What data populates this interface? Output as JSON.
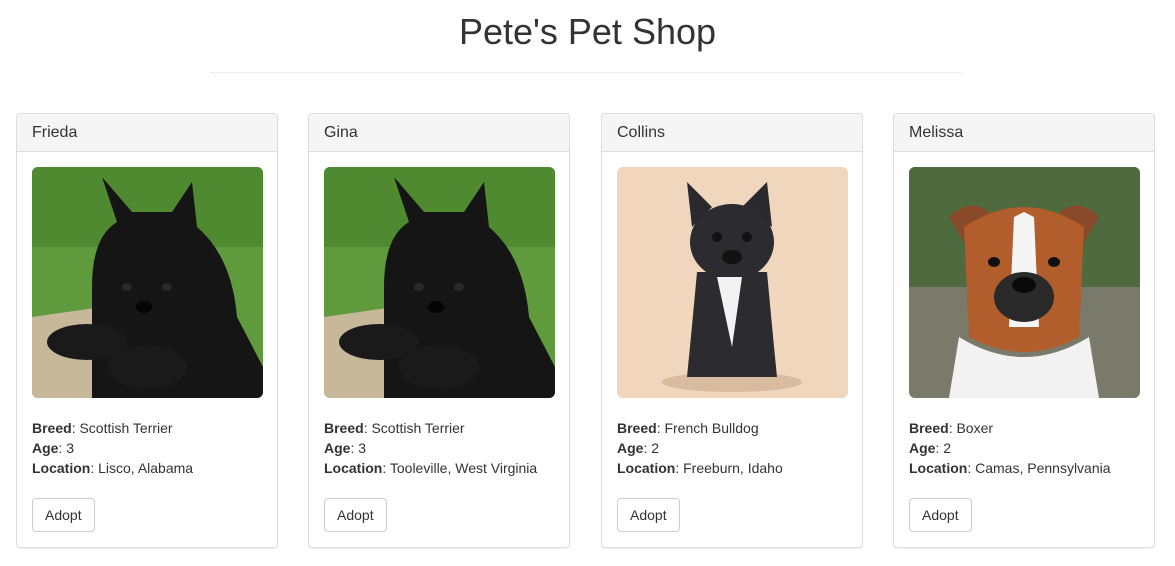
{
  "header": {
    "title": "Pete's Pet Shop"
  },
  "labels": {
    "breed": "Breed",
    "age": "Age",
    "location": "Location"
  },
  "pets": [
    {
      "name": "Frieda",
      "breed": "Scottish Terrier",
      "age": "3",
      "location": "Lisco, Alabama",
      "adopt_label": "Adopt",
      "photo": "scottish-terrier-photo"
    },
    {
      "name": "Gina",
      "breed": "Scottish Terrier",
      "age": "3",
      "location": "Tooleville, West Virginia",
      "adopt_label": "Adopt",
      "photo": "scottish-terrier-photo"
    },
    {
      "name": "Collins",
      "breed": "French Bulldog",
      "age": "2",
      "location": "Freeburn, Idaho",
      "adopt_label": "Adopt",
      "photo": "french-bulldog-photo"
    },
    {
      "name": "Melissa",
      "breed": "Boxer",
      "age": "2",
      "location": "Camas, Pennsylvania",
      "adopt_label": "Adopt",
      "photo": "boxer-photo"
    }
  ]
}
